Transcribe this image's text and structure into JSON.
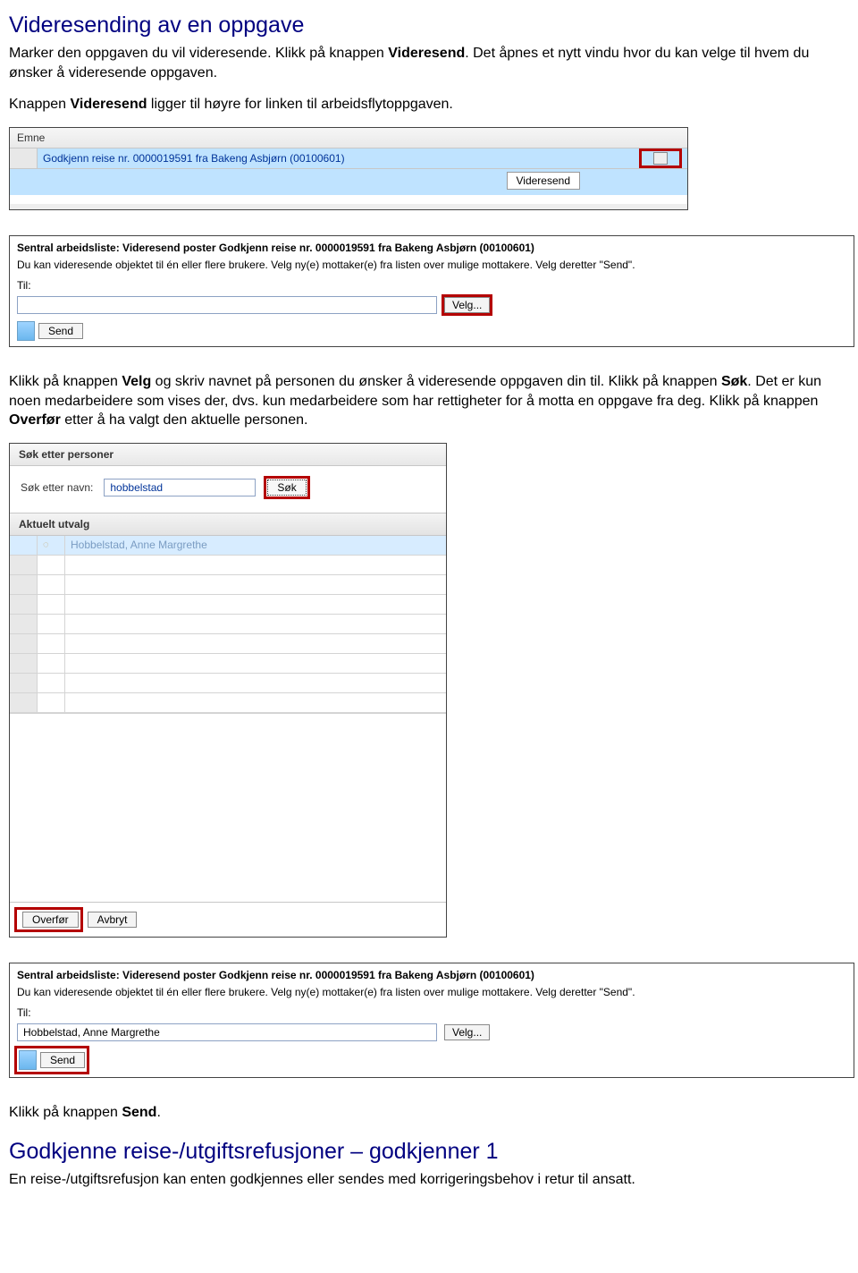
{
  "doc": {
    "title": "Videresending av en oppgave",
    "p1a": "Marker den oppgaven du vil videresende. Klikk på knappen ",
    "p1b_bold": "Videresend",
    "p1c": ". Det åpnes et nytt vindu hvor du kan velge til hvem du ønsker å videresende oppgaven.",
    "p2a": "Knappen ",
    "p2b_bold": "Videresend",
    "p2c": " ligger til høyre for linken til arbeidsflytoppgaven.",
    "p3a": "Klikk på knappen ",
    "p3b_bold": "Velg",
    "p3c": " og skriv navnet på personen du ønsker å videresende oppgaven din til. Klikk på knappen ",
    "p3d_bold": "Søk",
    "p3e": ". Det er kun noen medarbeidere som vises der, dvs. kun medarbeidere som har rettigheter for å motta en oppgave fra deg. Klikk på knappen ",
    "p3f_bold": "Overfør",
    "p3g": " etter å ha valgt den aktuelle personen.",
    "p4a": "Klikk på knappen ",
    "p4b_bold": "Send",
    "p4c": ".",
    "subtitle": "Godkjenne reise-/utgiftsrefusjoner – godkjenner 1",
    "p5": "En reise-/utgiftsrefusjon kan enten godkjennes eller sendes med korrigeringsbehov i retur til ansatt."
  },
  "shot1": {
    "header": "Emne",
    "row_text": "Godkjenn reise nr. 0000019591 fra Bakeng Asbjørn (00100601)",
    "videresend": "Videresend"
  },
  "shot2": {
    "heading": "Sentral arbeidsliste: Videresend poster Godkjenn reise nr. 0000019591 fra Bakeng Asbjørn (00100601)",
    "desc": "Du kan videresende objektet til én eller flere brukere. Velg ny(e) mottaker(e) fra listen over mulige mottakere. Velg deretter \"Send\".",
    "til": "Til:",
    "til_value": "",
    "velg": "Velg...",
    "send": "Send"
  },
  "shot3": {
    "title": "Søk etter personer",
    "search_label": "Søk etter navn:",
    "search_value": "hobbelstad",
    "sok": "Søk",
    "subtitle": "Aktuelt utvalg",
    "result": "Hobbelstad, Anne Margrethe",
    "overfor": "Overfør",
    "avbryt": "Avbryt"
  },
  "shot4": {
    "heading": "Sentral arbeidsliste: Videresend poster Godkjenn reise nr. 0000019591 fra Bakeng Asbjørn (00100601)",
    "desc": "Du kan videresende objektet til én eller flere brukere. Velg ny(e) mottaker(e) fra listen over mulige mottakere. Velg deretter \"Send\".",
    "til": "Til:",
    "til_value": "Hobbelstad, Anne Margrethe",
    "velg": "Velg...",
    "send": "Send"
  }
}
